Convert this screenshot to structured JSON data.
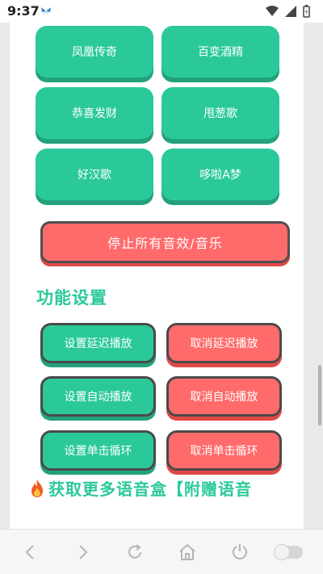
{
  "status_bar": {
    "time": "9:37",
    "app_icon": "butterfly-icon",
    "icons": [
      "wifi-icon",
      "signal-icon",
      "battery-icon"
    ]
  },
  "sound_buttons": [
    {
      "label": "凤凰传奇"
    },
    {
      "label": "百变酒精"
    },
    {
      "label": "恭喜发财"
    },
    {
      "label": "甩葱歌"
    },
    {
      "label": "好汉歌"
    },
    {
      "label": "哆啦A梦"
    }
  ],
  "stop_button": {
    "label": "停止所有音效/音乐"
  },
  "settings": {
    "title": "功能设置",
    "buttons": [
      {
        "label": "设置延迟播放"
      },
      {
        "label": "取消延迟播放"
      },
      {
        "label": "设置自动播放"
      },
      {
        "label": "取消自动播放"
      },
      {
        "label": "设置单击循环"
      },
      {
        "label": "取消单击循环"
      }
    ]
  },
  "promo": {
    "icon": "fire-icon",
    "text": "获取更多语音盒【附赠语音"
  },
  "nav_bar": {
    "icons": [
      "back-icon",
      "forward-icon",
      "refresh-icon",
      "home-icon",
      "power-icon",
      "toggle-switch"
    ]
  },
  "colors": {
    "accent_green": "#2bc99a",
    "accent_red": "#ff6b6b",
    "border_dark": "#4a4a4a"
  }
}
